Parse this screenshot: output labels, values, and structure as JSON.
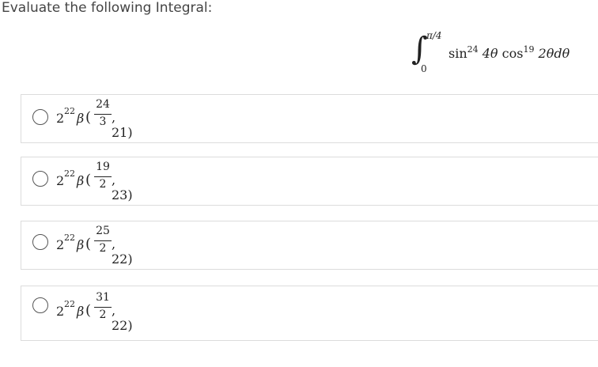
{
  "question": "Evaluate the following Integral:",
  "integral": {
    "upper": "π/4",
    "lower": "0",
    "sin_label": "sin",
    "sin_exp": "24",
    "sin_arg": "4θ",
    "cos_label": "cos",
    "cos_exp": "19",
    "cos_arg": "2θdθ"
  },
  "options": [
    {
      "base": "2",
      "exp": "22",
      "beta": "β",
      "lp": "(",
      "num": "24",
      "den": "3",
      "rest": ", 21)"
    },
    {
      "base": "2",
      "exp": "22",
      "beta": "β",
      "lp": "(",
      "num": "19",
      "den": "2",
      "rest": ", 23)"
    },
    {
      "base": "2",
      "exp": "22",
      "beta": "β",
      "lp": "(",
      "num": "25",
      "den": "2",
      "rest": ", 22)"
    },
    {
      "base": "2",
      "exp": "22",
      "beta": "β",
      "lp": "(",
      "num": "31",
      "den": "2",
      "rest": ", 22)"
    }
  ]
}
